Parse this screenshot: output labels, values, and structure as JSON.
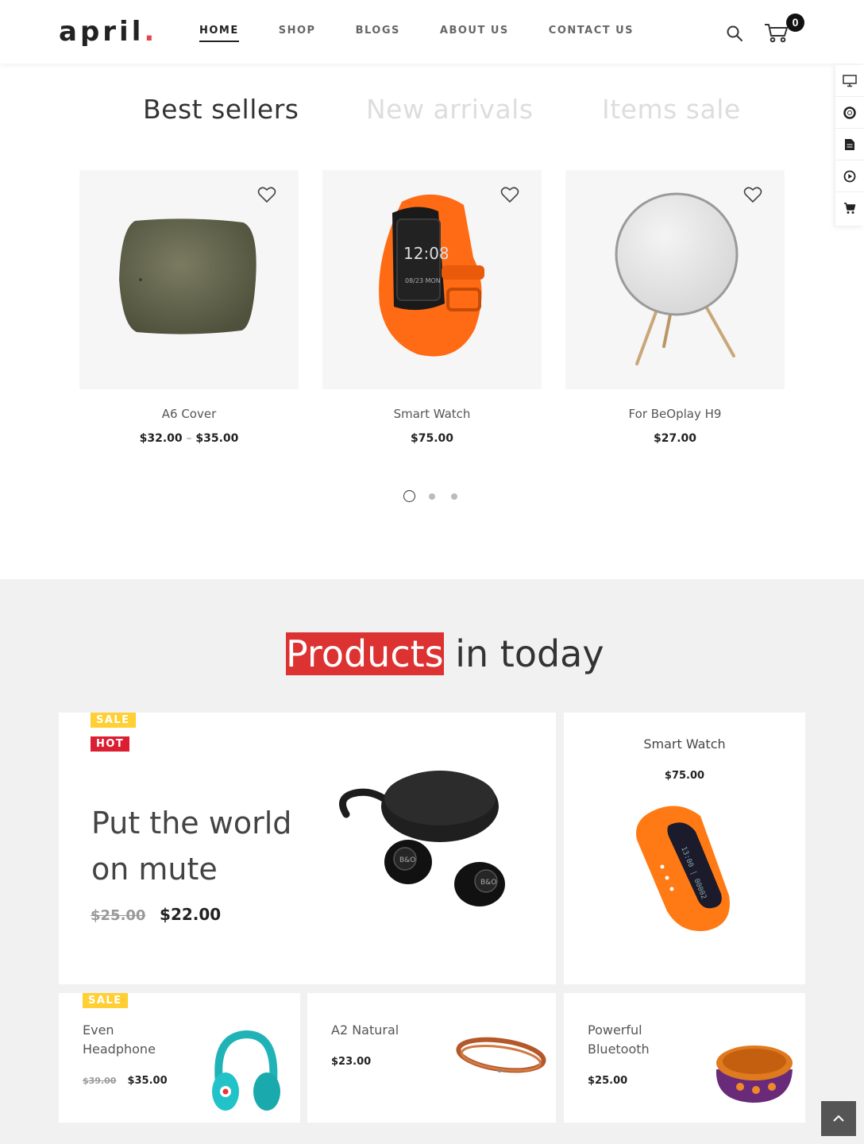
{
  "brand": {
    "name": "april",
    "dot": ".",
    "accent": "#e8434a"
  },
  "nav": {
    "items": [
      "HOME",
      "SHOP",
      "BLOGS",
      "ABOUT US",
      "CONTACT US"
    ],
    "active": "HOME"
  },
  "cart": {
    "count": "0"
  },
  "tools": [
    "monitor-icon",
    "lifebuoy-icon",
    "document-icon",
    "play-icon",
    "cart-icon"
  ],
  "tabs": [
    "Best sellers",
    "New arrivals",
    "Items sale"
  ],
  "carousel": {
    "products": [
      {
        "name": "A6 Cover",
        "price_from": "$32.00",
        "price_sep": "–",
        "price_to": "$35.00"
      },
      {
        "name": "Smart Watch",
        "price": "$75.00"
      },
      {
        "name": "For BeOplay H9",
        "price": "$27.00"
      }
    ],
    "page": 1,
    "pages": 3
  },
  "today": {
    "title_highlight": "Products",
    "title_rest": "in today",
    "highlight_color": "#dc3232",
    "featured": {
      "badges": [
        "SALE",
        "HOT"
      ],
      "title_line1": "Put the world",
      "title_line2": "on mute",
      "old_price": "$25.00",
      "price": "$22.00"
    },
    "side": {
      "name": "Smart Watch",
      "price": "$75.00"
    },
    "small": [
      {
        "badge": "SALE",
        "name_line1": "Even",
        "name_line2": "Headphone",
        "old_price": "$39.00",
        "price": "$35.00"
      },
      {
        "name_line1": "A2 Natural",
        "price": "$23.00"
      },
      {
        "name_line1": "Powerful",
        "name_line2": "Bluetooth",
        "price": "$25.00"
      }
    ]
  }
}
